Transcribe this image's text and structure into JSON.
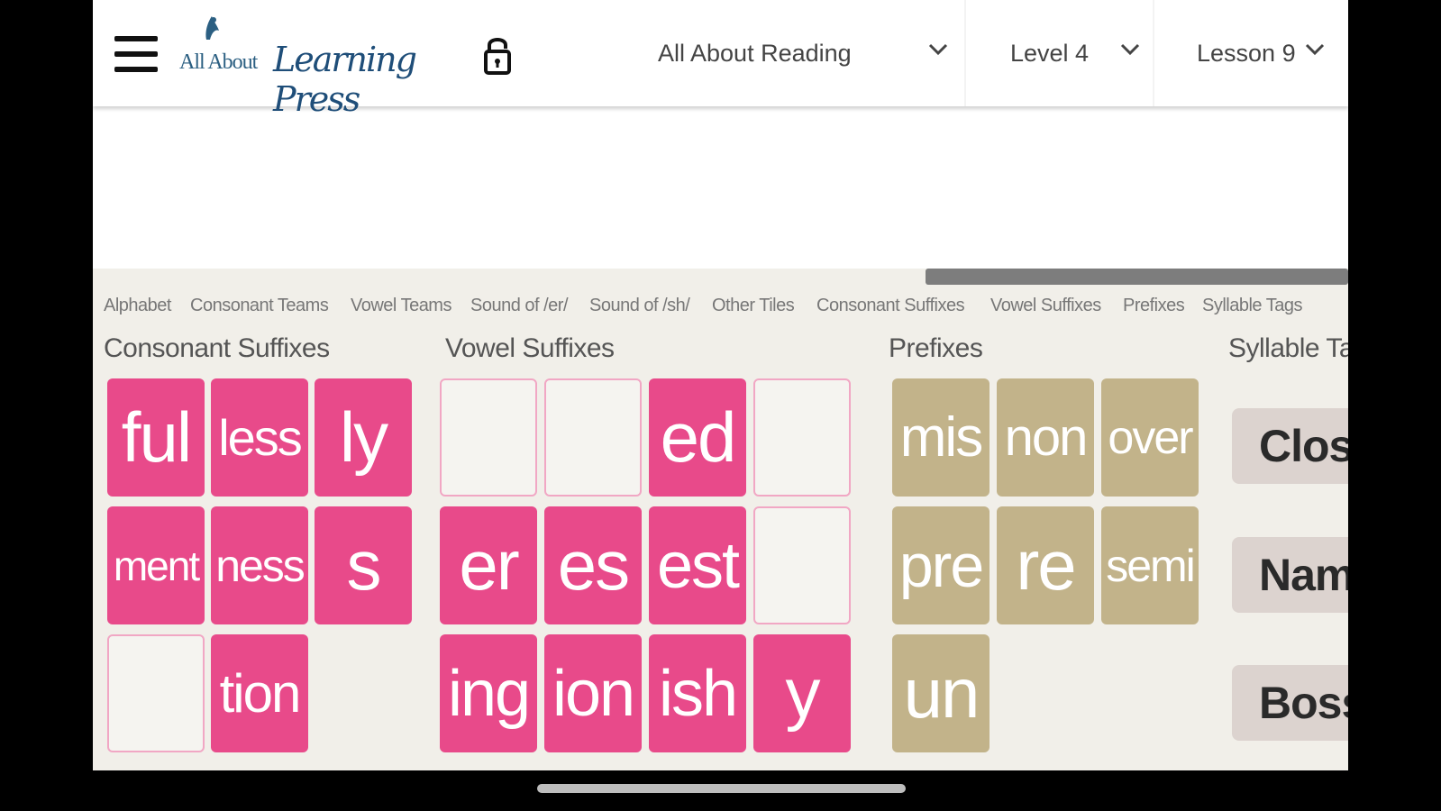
{
  "header": {
    "logo_small": "All About",
    "logo_big": "Learning Press",
    "dropdowns": {
      "program": "All About Reading",
      "level": "Level 4",
      "lesson": "Lesson 9"
    }
  },
  "tabs": [
    "Alphabet",
    "Consonant Teams",
    "Vowel Teams",
    "Sound of /er/",
    "Sound of /sh/",
    "Other Tiles",
    "Consonant Suffixes",
    "Vowel Suffixes",
    "Prefixes",
    "Syllable Tags"
  ],
  "sections": {
    "consonant_suffixes": {
      "title": "Consonant Suffixes",
      "tiles": [
        "ful",
        "less",
        "ly",
        "ment",
        "ness",
        "s",
        "",
        "tion"
      ]
    },
    "vowel_suffixes": {
      "title": "Vowel Suffixes",
      "tiles": [
        "",
        "",
        "ed",
        "",
        "er",
        "es",
        "est",
        "",
        "ing",
        "ion",
        "ish",
        "y"
      ]
    },
    "prefixes": {
      "title": "Prefixes",
      "tiles": [
        "mis",
        "non",
        "over",
        "pre",
        "re",
        "semi",
        "un"
      ]
    },
    "syllable_tags": {
      "title": "Syllable Ta",
      "tags": [
        "Clos",
        "Name",
        "Boss"
      ]
    }
  },
  "colors": {
    "tile_pink": "#e84a8a",
    "tile_tan": "#c2b38a",
    "tag_bg": "#dcd3cf",
    "panel_bg": "#f1efe9"
  }
}
